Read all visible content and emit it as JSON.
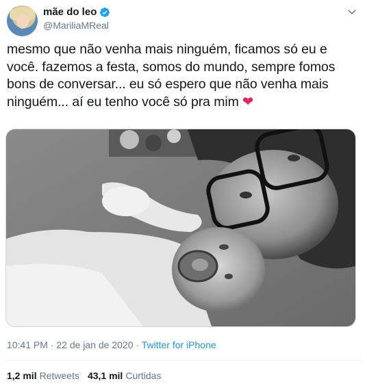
{
  "user": {
    "name": "mãe do leo",
    "handle": "@MariliaMReal"
  },
  "tweet": {
    "text": "mesmo que não venha mais ninguém, ficamos só eu e você. fazemos a festa, somos do mundo, sempre fomos bons de conversar... eu só espero que não venha mais ninguém... aí eu tenho você só pra mim",
    "emoji": "❤"
  },
  "meta": {
    "time": "10:41 PM",
    "separator": " · ",
    "date": "22 de jan de 2020",
    "source": "Twitter for iPhone"
  },
  "stats": {
    "retweets_count": "1,2 mil",
    "retweets_label": "Retweets",
    "likes_count": "43,1 mil",
    "likes_label": "Curtidas"
  },
  "colors": {
    "link": "#1b95e0",
    "verified": "#1da1f2",
    "heart": "#e0245e",
    "muted": "#657786"
  },
  "icons": {
    "verified": "verified-badge-icon",
    "menu": "chevron-down-icon"
  }
}
